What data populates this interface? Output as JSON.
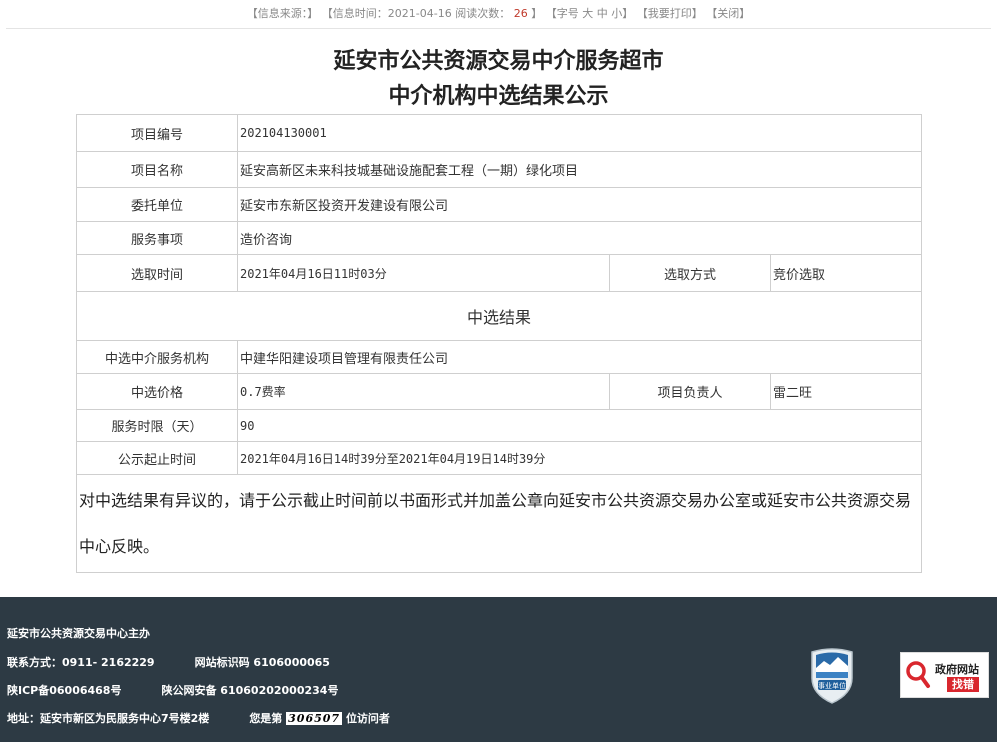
{
  "infobar": {
    "source": "【信息来源：】",
    "time": "【信息时间：2021-04-16",
    "views_label": "阅读次数：",
    "views": "26",
    "views_close": "】",
    "font_label": "【字号",
    "font_large": "大",
    "font_medium": "中",
    "font_small": "小】",
    "print": "【我要打印】",
    "close": "【关闭】"
  },
  "title": {
    "line1": "延安市公共资源交易中介服务超市",
    "line2": "中介机构中选结果公示"
  },
  "rows": {
    "project_no_label": "项目编号",
    "project_no": "202104130001",
    "project_name_label": "项目名称",
    "project_name": "延安高新区未来科技城基础设施配套工程（一期）绿化项目",
    "client_label": "委托单位",
    "client": "延安市东新区投资开发建设有限公司",
    "service_label": "服务事项",
    "service": "造价咨询",
    "select_time_label": "选取时间",
    "select_time": "2021年04月16日11时03分",
    "select_method_label": "选取方式",
    "select_method": "竞价选取",
    "section_title": "中选结果",
    "agency_label": "中选中介服务机构",
    "agency": "中建华阳建设项目管理有限责任公司",
    "price_label": "中选价格",
    "price": "0.7费率",
    "leader_label": "项目负责人",
    "leader": "雷二旺",
    "period_label": "服务时限（天）",
    "period": "90",
    "notice_label": "公示起止时间",
    "notice": "2021年04月16日14时39分至2021年04月19日14时39分",
    "note": "对中选结果有异议的，请于公示截止时间前以书面形式并加盖公章向延安市公共资源交易办公室或延安市公共资源交易中心反映。"
  },
  "footer": {
    "host": "延安市公共资源交易中心主办",
    "contact": "联系方式：0911- 2162229",
    "site_id": "网站标识码 6106000065",
    "icp": "陕ICP备06006468号",
    "police": "陕公网安备 61060202000234号",
    "address": "地址：延安市新区为民服务中心7号楼2楼",
    "visitor_prefix": "您是第",
    "visitor_count": "306507",
    "visitor_suffix": "位访问者",
    "badge_text": "事业单位",
    "findbox_line1": "政府网站",
    "findbox_line2": "找错"
  },
  "colors": {
    "footer_bg": "#2d3a44",
    "accent_red": "#d9272e",
    "border": "#cfcfcf"
  }
}
